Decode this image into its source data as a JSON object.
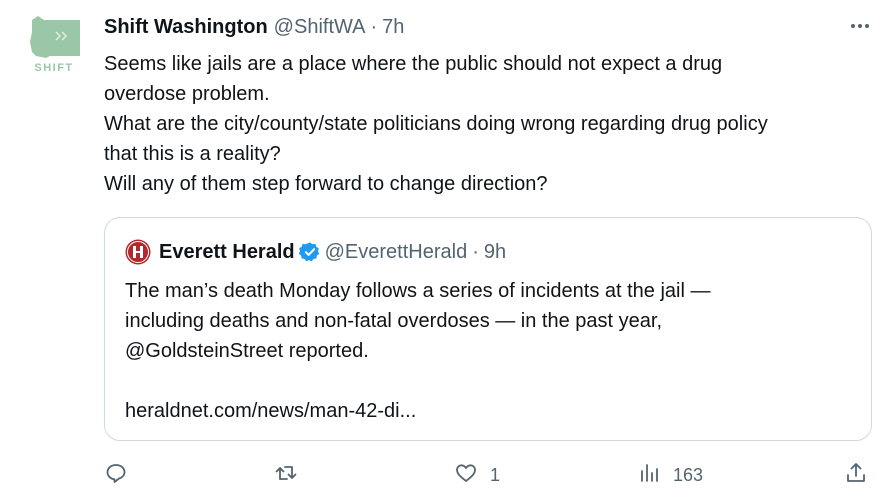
{
  "tweet": {
    "avatar": {
      "label": "SHIFT",
      "icon": "washington-state-map-icon",
      "color": "#9ac7a8"
    },
    "display_name": "Shift Washington",
    "handle": "@ShiftWA",
    "separator": "·",
    "time": "7h",
    "more_icon": "ellipsis-icon",
    "text_lines": [
      "Seems like jails are a place where the public should not expect a drug",
      "overdose problem.",
      "What are the city/county/state politicians doing wrong regarding drug policy",
      "that this is a reality?",
      "Will any of them step forward to change direction?"
    ],
    "quote": {
      "logo_icon": "everett-herald-h-logo-icon",
      "display_name": "Everett Herald",
      "verified_icon": "verified-badge-icon",
      "handle": "@EverettHerald",
      "separator": "·",
      "time": "9h",
      "text_lines": [
        "The man’s death Monday follows a series of incidents at the jail —",
        "including deaths and non-fatal overdoses — in the past year,",
        "@GoldsteinStreet reported."
      ],
      "link": "heraldnet.com/news/man-42-di..."
    },
    "actions": {
      "reply": {
        "icon": "reply-icon",
        "count": ""
      },
      "retweet": {
        "icon": "retweet-icon",
        "count": ""
      },
      "like": {
        "icon": "heart-icon",
        "count": "1"
      },
      "views": {
        "icon": "views-chart-icon",
        "count": "163"
      },
      "share": {
        "icon": "share-icon",
        "count": ""
      }
    },
    "colors": {
      "text": "#0f1419",
      "secondary": "#536471",
      "border": "#cfd9de",
      "verified": "#1d9bf0",
      "herald_red": "#b3282d"
    }
  }
}
